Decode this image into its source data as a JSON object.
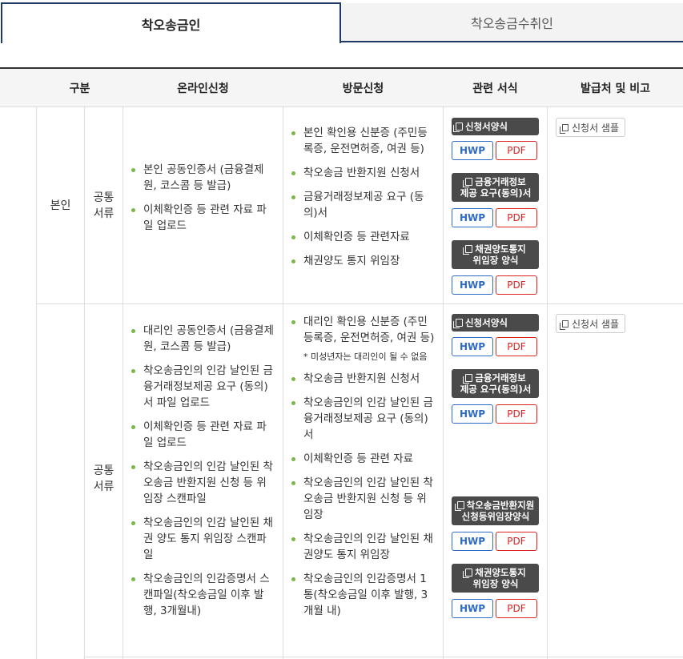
{
  "tabs": [
    {
      "label": "착오송금인",
      "active": true
    },
    {
      "label": "착오송금수취인",
      "active": false
    }
  ],
  "table": {
    "headers": [
      "구분",
      "온라인신청",
      "방문신청",
      "관련 서식",
      "발급처 및 비고"
    ],
    "rows": [
      {
        "category": "본인",
        "subcategory": [
          "공통",
          "서류"
        ],
        "online": [
          "본인 공동인증서 (금융결제원, 코스콤 등 발급)",
          "이체확인증 등 관련 자료 파일 업로드"
        ],
        "visit": [
          "본인 확인용 신분증 (주민등록증, 운전면허증, 여권 등)",
          "착오송금 반환지원 신청서",
          "금융거래정보제공 요구 (동의)서",
          "이체확인증 등 관련자료",
          "채권양도 통지 위임장"
        ],
        "forms": [
          {
            "title": [
              "신청서양식"
            ]
          },
          {
            "title": [
              "금융거래정보",
              "제공 요구(동의)서"
            ]
          },
          {
            "title": [
              "채권양도통지",
              "위임장 양식"
            ]
          }
        ],
        "sample_label": "신청서 샘플"
      },
      {
        "category": "",
        "subcategory": [
          "공통",
          "서류"
        ],
        "online": [
          "대리인 공동인증서 (금융결제원, 코스콤 등 발급)",
          "착오송금인의 인감 날인된 금융거래정보제공 요구 (동의)서 파일 업로드",
          "이체확인증 등 관련 자료 파일 업로드",
          "착오송금인의 인감 날인된 착오송금 반환지원 신청 등 위임장 스캔파일",
          "착오송금인의 인감 날인된 채권 양도 통지 위임장 스캔파일",
          "착오송금인의 인감증명서 스캔파일(착오송금일 이후 발행, 3개월내)"
        ],
        "visit": [
          "대리인 확인용 신분증 (주민등록증, 운전면허증, 여권 등)",
          "착오송금 반환지원 신청서",
          "착오송금인의 인감 날인된 금융거래정보제공 요구 (동의)서",
          "이체확인증 등 관련 자료",
          "착오송금인의 인감 날인된 착오송금 반환지원 신청 등 위임장",
          "착오송금인의 인감 날인된 채권양도 통지 위임장",
          "착오송금인의 인감증명서 1통(착오송금일 이후 발행, 3개월 내)"
        ],
        "visit_note": "* 미성년자는 대리인이 될 수 없음",
        "forms": [
          {
            "title": [
              "신청서양식"
            ]
          },
          {
            "title": [
              "금융거래정보",
              "제공 요구(동의)서"
            ]
          },
          {
            "title": [
              "착오송금반환지원",
              "신청등위임장양식"
            ]
          },
          {
            "title": [
              "채권양도통지",
              "위임장 양식"
            ]
          }
        ],
        "sample_label": "신청서 샘플"
      }
    ],
    "hwp_label": "HWP",
    "pdf_label": "PDF"
  },
  "colors": {
    "tab_border": "#1f3a66",
    "bullet": "#7ab648",
    "hwp": "#2e6bc6",
    "pdf": "#dd2222",
    "form_title_bg": "#4a4a4a"
  }
}
